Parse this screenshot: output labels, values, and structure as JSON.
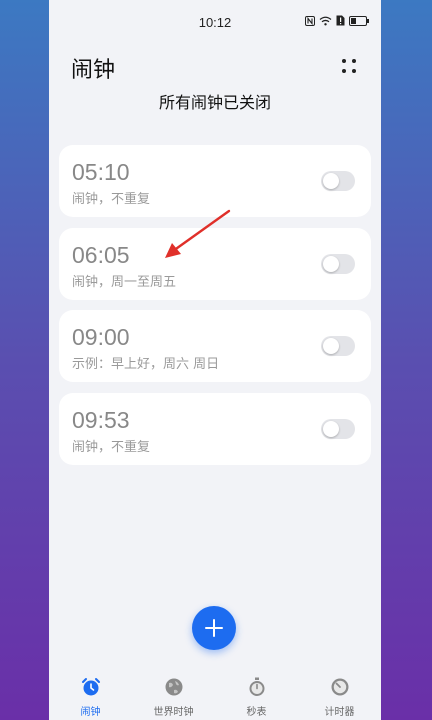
{
  "status_bar": {
    "time": "10:12",
    "icons": [
      "nfc-icon",
      "wifi-icon",
      "sim-alert-icon",
      "battery-icon"
    ]
  },
  "header": {
    "title": "闹钟",
    "menu_icon": "more-dots-icon",
    "subtitle": "所有闹钟已关闭"
  },
  "alarms": [
    {
      "time": "05:10",
      "desc": "闹钟，不重复",
      "enabled": false
    },
    {
      "time": "06:05",
      "desc": "闹钟，周一至周五",
      "enabled": false
    },
    {
      "time": "09:00",
      "desc": "示例：早上好，周六 周日",
      "enabled": false
    },
    {
      "time": "09:53",
      "desc": "闹钟，不重复",
      "enabled": false
    }
  ],
  "fab": {
    "icon": "plus-icon"
  },
  "tabs": [
    {
      "label": "闹钟",
      "icon": "alarm-clock-icon",
      "active": true
    },
    {
      "label": "世界时钟",
      "icon": "globe-icon",
      "active": false
    },
    {
      "label": "秒表",
      "icon": "stopwatch-icon",
      "active": false
    },
    {
      "label": "计时器",
      "icon": "timer-icon",
      "active": false
    }
  ],
  "colors": {
    "accent": "#1d6cf0",
    "annotation_arrow": "#e0302a"
  }
}
